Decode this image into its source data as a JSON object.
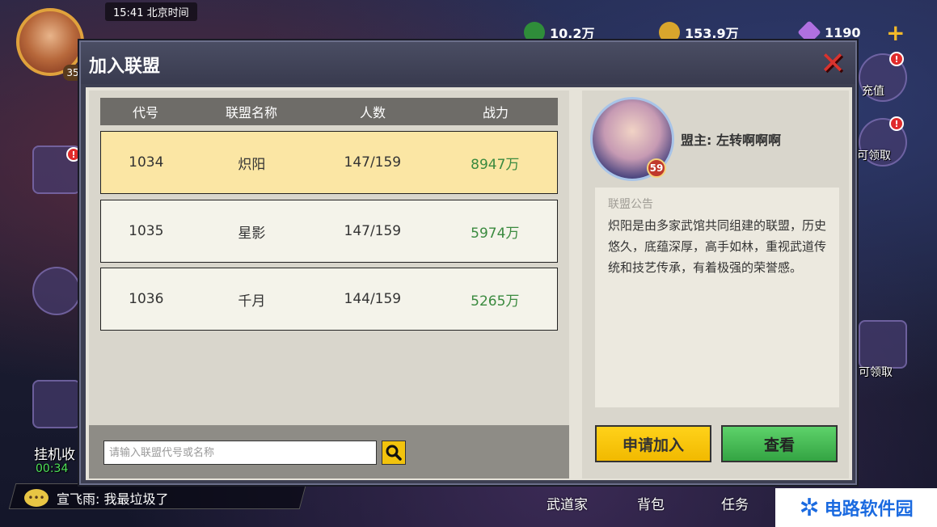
{
  "hud": {
    "clock": "15:41 北京时间",
    "player_level": "35",
    "resources": [
      {
        "icon": "jade-coin-icon",
        "value": "10.2万"
      },
      {
        "icon": "gold-coin-icon",
        "value": "153.9万"
      },
      {
        "icon": "diamond-icon",
        "value": "1190"
      }
    ],
    "add_label": "+",
    "side_right": [
      "充值",
      "可领取",
      "可领取"
    ],
    "idle_label": "挂机收",
    "idle_timer": "00:34",
    "chat": {
      "text": "宣飞雨: 我最垃圾了"
    },
    "bottom_nav": [
      "武道家",
      "背包",
      "任务"
    ]
  },
  "dialog": {
    "title": "加入联盟",
    "close_label": "✕",
    "table": {
      "headers": [
        "代号",
        "联盟名称",
        "人数",
        "战力"
      ],
      "rows": [
        {
          "id": "1034",
          "name": "炽阳",
          "members": "147/159",
          "power": "8947万"
        },
        {
          "id": "1035",
          "name": "星影",
          "members": "147/159",
          "power": "5974万"
        },
        {
          "id": "1036",
          "name": "千月",
          "members": "144/159",
          "power": "5265万"
        }
      ],
      "selected_row": 0
    },
    "search": {
      "placeholder": "请输入联盟代号或名称",
      "value": ""
    },
    "leader": {
      "level": "59",
      "label": "盟主: 左转啊啊啊"
    },
    "notice": {
      "title": "联盟公告",
      "text": "炽阳是由多家武馆共同组建的联盟，历史悠久，底蕴深厚，高手如林，重视武道传统和技艺传承，有着极强的荣誉感。"
    },
    "buttons": {
      "apply": "申请加入",
      "view": "查看"
    }
  },
  "watermark": {
    "text": "电路软件园"
  }
}
